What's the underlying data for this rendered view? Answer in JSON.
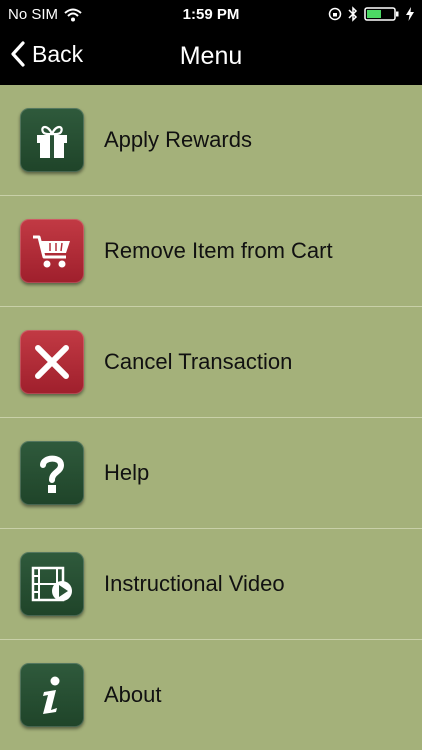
{
  "status_bar": {
    "carrier": "No SIM",
    "time": "1:59 PM"
  },
  "nav": {
    "back_label": "Back",
    "title": "Menu"
  },
  "menu": [
    {
      "label": "Apply Rewards",
      "icon": "gift-icon",
      "color": "#2a5236"
    },
    {
      "label": "Remove Item from Cart",
      "icon": "cart-icon",
      "color": "#b22f3a"
    },
    {
      "label": "Cancel Transaction",
      "icon": "close-icon",
      "color": "#b22f3a"
    },
    {
      "label": "Help",
      "icon": "question-icon",
      "color": "#2a5236"
    },
    {
      "label": "Instructional Video",
      "icon": "video-icon",
      "color": "#2a5236"
    },
    {
      "label": "About",
      "icon": "info-icon",
      "color": "#2a5236"
    }
  ],
  "colors": {
    "background": "#a4b17a",
    "bar": "#000000"
  }
}
